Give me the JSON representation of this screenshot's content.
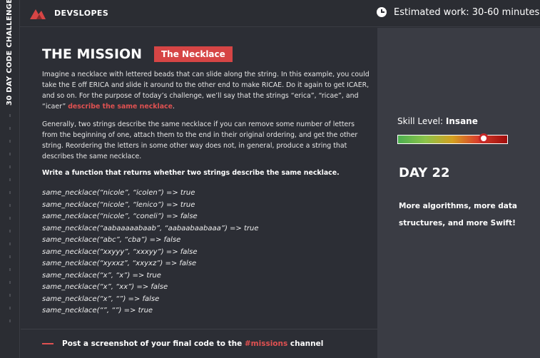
{
  "sidebar": {
    "vertical_label": "30 DAY CODE CHALLENGE"
  },
  "header": {
    "brand": "DEVSLOPES",
    "estimate": "Estimated work: 30-60 minutes",
    "logo_color": "#d64545"
  },
  "mission": {
    "title": "THE MISSION",
    "badge": "The Necklace",
    "p1": "Imagine a necklace with lettered beads that can slide along the string. In this example, you could take the E off ERICA and slide it around to the other end to make RICAE. Do it again to get ICAER, and so on. For the purpose of today’s challenge, we’ll say that the strings “erica”, “ricae”, and “icaer” ",
    "p1_link": "describe the same necklace",
    "p1_end": ".",
    "p2": "Generally, two strings describe the same necklace if you can remove some number of letters from the beginning of one, attach them to the end in their original ordering, and get the other string. Reordering the letters in some other way does not, in general, produce a string that describes the same necklace.",
    "p3": "Write a function that returns whether two strings describe the same necklace.",
    "examples": [
      "same_necklace(“nicole”, “icolen”) => true",
      "same_necklace(“nicole”, “lenico”) => true",
      "same_necklace(“nicole”, “coneli”) => false",
      "same_necklace(“aabaaaaabaab”, “aabaabaabaaa”) => true",
      "same_necklace(“abc”, “cba”) => false",
      "same_necklace(“xxyyy”, “xxxyy”) => false",
      "same_necklace(“xyxxz”, “xxyxz”) => false",
      "same_necklace(“x”, “x”) => true",
      "same_necklace(“x”, “xx”) => false",
      "same_necklace(“x”, “”) => false",
      "same_necklace(“”, “”) => true"
    ]
  },
  "footer": {
    "prefix": "Post a screenshot of your final code to the ",
    "channel": "#missions",
    "suffix": " channel"
  },
  "side": {
    "skill_prefix": "Skill Level: ",
    "skill_value": "Insane",
    "skill_level": 0.78,
    "day": "DAY 22",
    "desc": "More algorithms, more data structures, and more Swift!"
  }
}
